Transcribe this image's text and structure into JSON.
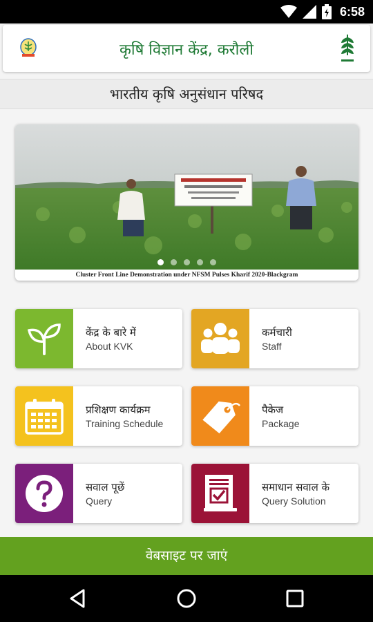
{
  "status_bar": {
    "time": "6:58"
  },
  "header": {
    "title": "कृषि विज्ञान केंद्र, करौली"
  },
  "subheader": {
    "title": "भारतीय कृषि अनुसंधान परिषद"
  },
  "carousel": {
    "caption": "Cluster Front Line Demonstration under NFSM Pulses Kharif 2020-Blackgram",
    "slide_count": 5,
    "active_slide": 1
  },
  "menu": {
    "items": [
      {
        "hindi": "केंद्र के बारे में",
        "english": "About KVK",
        "color": "#7cb82f",
        "icon": "sprout-icon"
      },
      {
        "hindi": "कर्मचारी",
        "english": "Staff",
        "color": "#e3a623",
        "icon": "people-icon"
      },
      {
        "hindi": "प्रशिक्षण कार्यक्रम",
        "english": "Training Schedule",
        "color": "#f4c21e",
        "icon": "calendar-icon"
      },
      {
        "hindi": "पैकेज",
        "english": "Package",
        "color": "#f08a1b",
        "icon": "tag-icon"
      },
      {
        "hindi": "सवाल पूछें",
        "english": "Query",
        "color": "#7b1f7b",
        "icon": "question-icon"
      },
      {
        "hindi": "समाधान सवाल के",
        "english": "Query Solution",
        "color": "#9b1337",
        "icon": "document-check-icon"
      }
    ]
  },
  "footer": {
    "website_button": "वेबसाइट पर जाएं"
  },
  "colors": {
    "brand_green": "#1f7a35",
    "button_green": "#63a11f"
  }
}
